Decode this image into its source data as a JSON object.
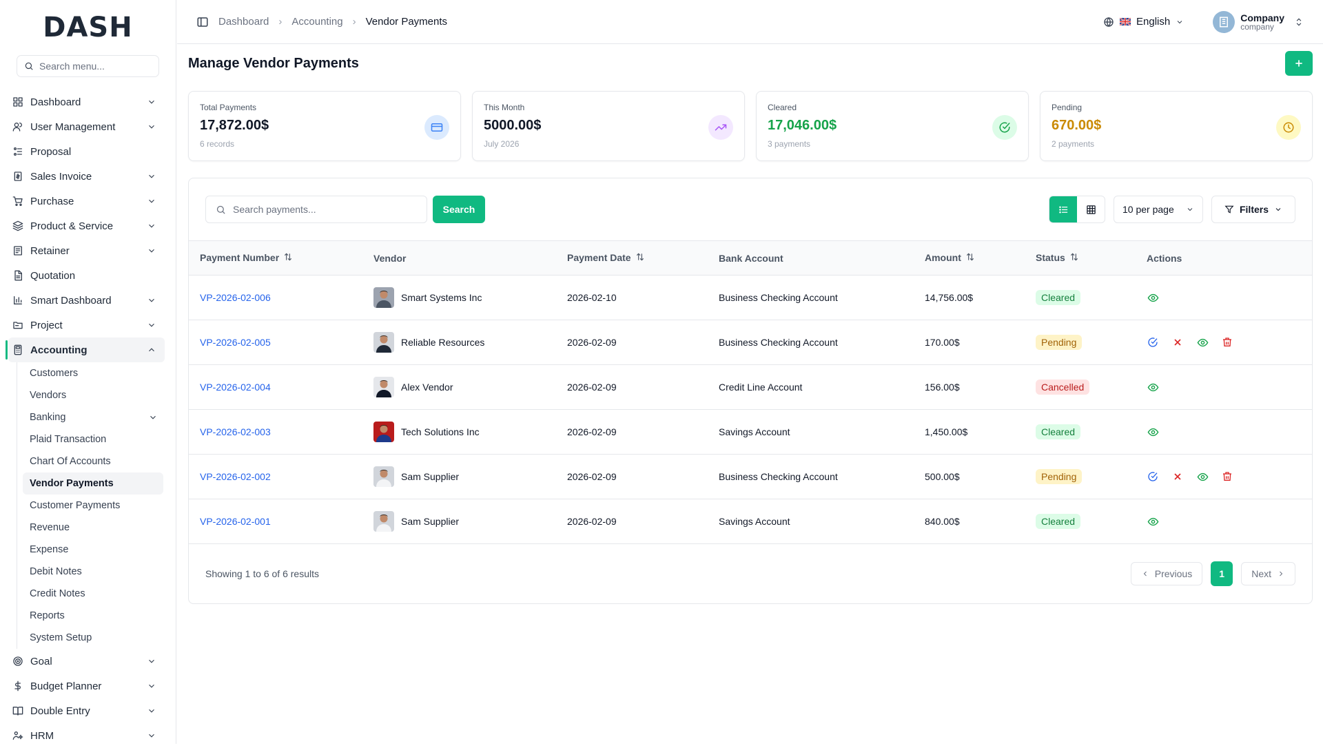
{
  "app": {
    "logo": "DASH"
  },
  "sidebar": {
    "search_placeholder": "Search menu...",
    "items": [
      {
        "label": "Dashboard",
        "icon": "grid-icon",
        "expandable": true
      },
      {
        "label": "User Management",
        "icon": "users-icon",
        "expandable": true
      },
      {
        "label": "Proposal",
        "icon": "proposal-icon",
        "expandable": false
      },
      {
        "label": "Sales Invoice",
        "icon": "invoice-icon",
        "expandable": true
      },
      {
        "label": "Purchase",
        "icon": "cart-icon",
        "expandable": true
      },
      {
        "label": "Product & Service",
        "icon": "layers-icon",
        "expandable": true
      },
      {
        "label": "Retainer",
        "icon": "retainer-icon",
        "expandable": true
      },
      {
        "label": "Quotation",
        "icon": "file-icon",
        "expandable": false
      },
      {
        "label": "Smart Dashboard",
        "icon": "chart-icon",
        "expandable": true
      },
      {
        "label": "Project",
        "icon": "folder-icon",
        "expandable": true
      },
      {
        "label": "Accounting",
        "icon": "calculator-icon",
        "expandable": true,
        "active": true
      }
    ],
    "accounting_sub": [
      {
        "label": "Customers"
      },
      {
        "label": "Vendors"
      },
      {
        "label": "Banking",
        "expandable": true
      },
      {
        "label": "Plaid Transaction"
      },
      {
        "label": "Chart Of Accounts"
      },
      {
        "label": "Vendor Payments",
        "active": true
      },
      {
        "label": "Customer Payments"
      },
      {
        "label": "Revenue"
      },
      {
        "label": "Expense"
      },
      {
        "label": "Debit Notes"
      },
      {
        "label": "Credit Notes"
      },
      {
        "label": "Reports"
      },
      {
        "label": "System Setup"
      }
    ],
    "bottom_items": [
      {
        "label": "Goal",
        "icon": "target-icon",
        "expandable": true
      },
      {
        "label": "Budget Planner",
        "icon": "dollar-icon",
        "expandable": true
      },
      {
        "label": "Double Entry",
        "icon": "book-icon",
        "expandable": true
      },
      {
        "label": "HRM",
        "icon": "hrm-icon",
        "expandable": true
      }
    ]
  },
  "topbar": {
    "breadcrumb": [
      "Dashboard",
      "Accounting",
      "Vendor Payments"
    ],
    "language": "English",
    "company_name": "Company",
    "company_sub": "company"
  },
  "page": {
    "title": "Manage Vendor Payments"
  },
  "stats": [
    {
      "label": "Total Payments",
      "value": "17,872.00$",
      "sub": "6 records",
      "color": "#111827",
      "icon": "credit-card-icon",
      "icon_bg": "#dbeafe",
      "icon_color": "#3b82f6"
    },
    {
      "label": "This Month",
      "value": "5000.00$",
      "sub": "July 2026",
      "color": "#111827",
      "icon": "trending-up-icon",
      "icon_bg": "#f3e8ff",
      "icon_color": "#a855f7"
    },
    {
      "label": "Cleared",
      "value": "17,046.00$",
      "sub": "3 payments",
      "color": "#16a34a",
      "icon": "check-circle-icon",
      "icon_bg": "#dcfce7",
      "icon_color": "#16a34a"
    },
    {
      "label": "Pending",
      "value": "670.00$",
      "sub": "2 payments",
      "color": "#ca8a04",
      "icon": "clock-icon",
      "icon_bg": "#fef9c3",
      "icon_color": "#ca8a04"
    }
  ],
  "toolbar": {
    "search_placeholder": "Search payments...",
    "search_label": "Search",
    "per_page": "10 per page",
    "filters_label": "Filters"
  },
  "table": {
    "columns": [
      "Payment Number",
      "Vendor",
      "Payment Date",
      "Bank Account",
      "Amount",
      "Status",
      "Actions"
    ],
    "rows": [
      {
        "number": "VP-2026-02-006",
        "vendor": "Smart Systems Inc",
        "date": "2026-02-10",
        "bank": "Business Checking Account",
        "amount": "14,756.00$",
        "status": "Cleared"
      },
      {
        "number": "VP-2026-02-005",
        "vendor": "Reliable Resources",
        "date": "2026-02-09",
        "bank": "Business Checking Account",
        "amount": "170.00$",
        "status": "Pending"
      },
      {
        "number": "VP-2026-02-004",
        "vendor": "Alex Vendor",
        "date": "2026-02-09",
        "bank": "Credit Line Account",
        "amount": "156.00$",
        "status": "Cancelled"
      },
      {
        "number": "VP-2026-02-003",
        "vendor": "Tech Solutions Inc",
        "date": "2026-02-09",
        "bank": "Savings Account",
        "amount": "1,450.00$",
        "status": "Cleared"
      },
      {
        "number": "VP-2026-02-002",
        "vendor": "Sam Supplier",
        "date": "2026-02-09",
        "bank": "Business Checking Account",
        "amount": "500.00$",
        "status": "Pending"
      },
      {
        "number": "VP-2026-02-001",
        "vendor": "Sam Supplier",
        "date": "2026-02-09",
        "bank": "Savings Account",
        "amount": "840.00$",
        "status": "Cleared"
      }
    ]
  },
  "footer": {
    "showing": "Showing 1 to 6 of 6 results",
    "previous": "Previous",
    "page": "1",
    "next": "Next"
  },
  "colors": {
    "accent": "#10b981",
    "link": "#2563eb"
  }
}
